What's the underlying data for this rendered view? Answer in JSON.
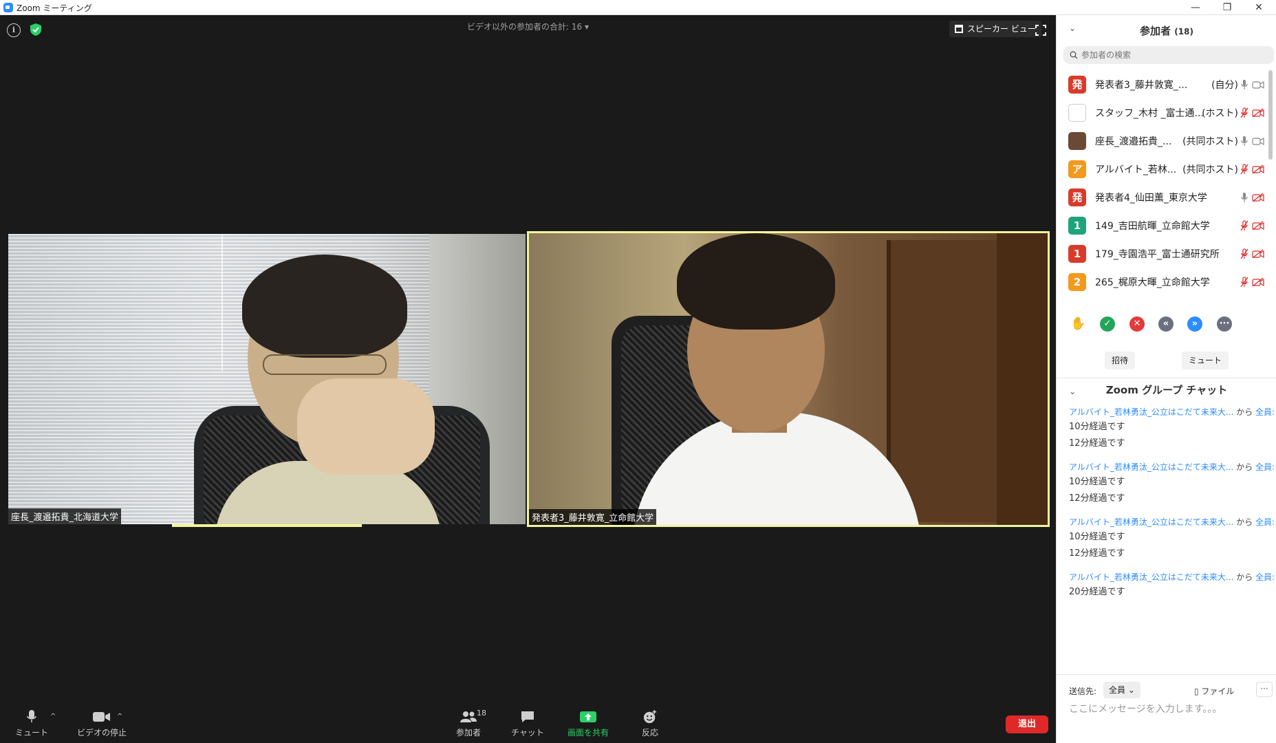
{
  "window": {
    "title": "Zoom ミーティング",
    "controls": [
      "—",
      "❐",
      "✕"
    ]
  },
  "meeting": {
    "viewer_count": "ビデオ以外の参加者の合計: 16 ▾",
    "speaker_view": "スピーカー ビュー",
    "tiles": [
      {
        "name": "座長_渡邉拓貴_北海道大学"
      },
      {
        "name": "発表者3_藤井敦寛_立命館大学"
      }
    ]
  },
  "toolbar": {
    "mute": "ミュート",
    "stop_video": "ビデオの停止",
    "participants": "参加者",
    "participants_count": "18",
    "chat": "チャット",
    "share_screen": "画面を共有",
    "reactions": "反応",
    "leave": "退出",
    "share_color": "#2bd067",
    "leave_color": "#e02828"
  },
  "panel": {
    "participants_title": "参加者",
    "participants_count": "(18)",
    "search_placeholder": "参加者の検索",
    "participants": [
      {
        "avatar": "発",
        "avatar_color": "#d93b2b",
        "name": "発表者3_藤井敦寛_...",
        "role": "(自分)",
        "mic": "on",
        "video": "on"
      },
      {
        "avatar": "",
        "avatar_color": "#ffffff",
        "name": "スタッフ_木村 _富士通...",
        "role": "(ホスト)",
        "mic": "muted",
        "video": "off"
      },
      {
        "avatar": "",
        "avatar_color": "#6b4a35",
        "name": "座長_渡邉拓貴_...",
        "role": "(共同ホスト)",
        "mic": "on",
        "video": "on"
      },
      {
        "avatar": "ア",
        "avatar_color": "#f39a1e",
        "name": "アルバイト_若林...",
        "role": "(共同ホスト)",
        "mic": "muted",
        "video": "off"
      },
      {
        "avatar": "発",
        "avatar_color": "#d93b2b",
        "name": "発表者4_仙田薫_東京大学",
        "role": "",
        "mic": "on",
        "video": "off"
      },
      {
        "avatar": "1",
        "avatar_color": "#1fa37a",
        "name": "149_吉田航暉_立命館大学",
        "role": "",
        "mic": "muted",
        "video": "off"
      },
      {
        "avatar": "1",
        "avatar_color": "#d93b2b",
        "name": "179_寺園浩平_富士通研究所",
        "role": "",
        "mic": "muted",
        "video": "off"
      },
      {
        "avatar": "2",
        "avatar_color": "#f39a1e",
        "name": "265_梶原大暉_立命館大学",
        "role": "",
        "mic": "muted",
        "video": "off"
      }
    ],
    "reactions": [
      {
        "name": "raise-hand",
        "symbol": "✋",
        "color": "#2d8cff"
      },
      {
        "name": "yes",
        "symbol": "✓",
        "color": "#23a55a"
      },
      {
        "name": "no",
        "symbol": "✕",
        "color": "#e5393b"
      },
      {
        "name": "slower",
        "symbol": "«",
        "color": "#6b7080"
      },
      {
        "name": "faster",
        "symbol": "»",
        "color": "#2d8cff"
      },
      {
        "name": "more",
        "symbol": "···",
        "color": "#6b7080"
      }
    ],
    "invite": "招待",
    "mute_all": "ミュート",
    "chat_title": "Zoom グループ チャット",
    "messages": [
      {
        "from": "アルバイト_若林勇汰_公立はこだて未来大...",
        "to": "全員:",
        "lines": [
          "10分経過です",
          "12分経過です"
        ]
      },
      {
        "from": "アルバイト_若林勇汰_公立はこだて未来大...",
        "to": "全員:",
        "lines": [
          "10分経過です",
          "12分経過です"
        ]
      },
      {
        "from": "アルバイト_若林勇汰_公立はこだて未来大...",
        "to": "全員:",
        "lines": [
          "10分経過です",
          "12分経過です"
        ]
      },
      {
        "from": "アルバイト_若林勇汰_公立はこだて未来大...",
        "to": "全員:",
        "lines": [
          "20分経過です"
        ]
      }
    ],
    "from_word": "から",
    "send_to_label": "送信先:",
    "send_to_value": "全員",
    "file_label": "ファイル",
    "more_label": "···",
    "input_placeholder": "ここにメッセージを入力します。。。"
  }
}
